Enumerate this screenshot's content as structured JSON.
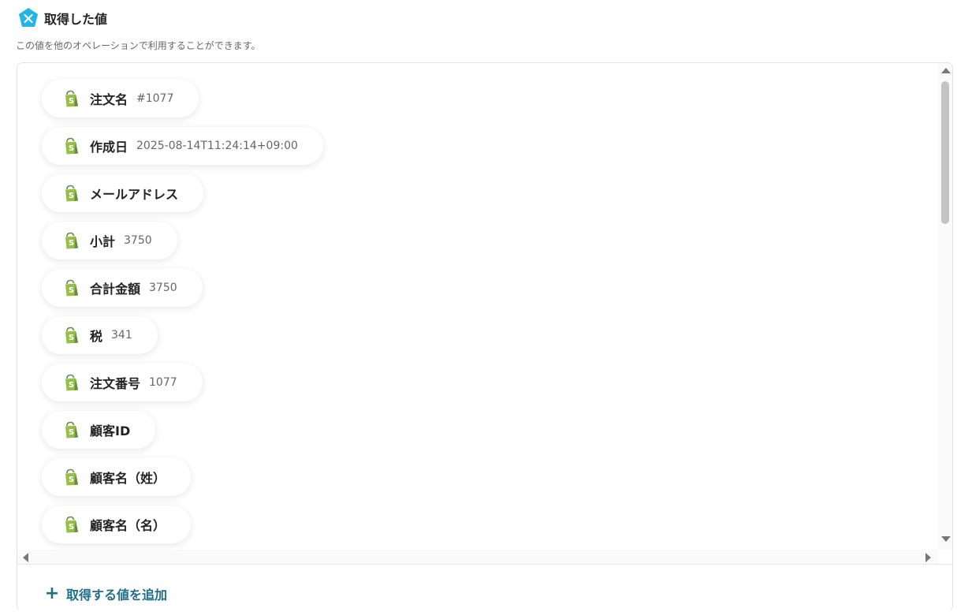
{
  "header": {
    "title": "取得した値",
    "subtitle": "この値を他のオペレーションで利用することができます。",
    "icon": "yoom-x-icon",
    "icon_color": "#24b5e8"
  },
  "values": [
    {
      "label": "注文名",
      "value": "#1077"
    },
    {
      "label": "作成日",
      "value": "2025-08-14T11:24:14+09:00"
    },
    {
      "label": "メールアドレス",
      "value": ""
    },
    {
      "label": "小計",
      "value": "3750"
    },
    {
      "label": "合計金額",
      "value": "3750"
    },
    {
      "label": "税",
      "value": "341"
    },
    {
      "label": "注文番号",
      "value": "1077"
    },
    {
      "label": "顧客ID",
      "value": ""
    },
    {
      "label": "顧客名（姓）",
      "value": ""
    },
    {
      "label": "顧客名（名）",
      "value": ""
    }
  ],
  "item_icon": "shopify-bag-icon",
  "colors": {
    "shopify_green": "#95bf47",
    "shopify_dark": "#5e8e3e",
    "accent": "#1f6e87"
  },
  "actions": {
    "add_label": "取得する値を追加",
    "add_icon": "+"
  }
}
